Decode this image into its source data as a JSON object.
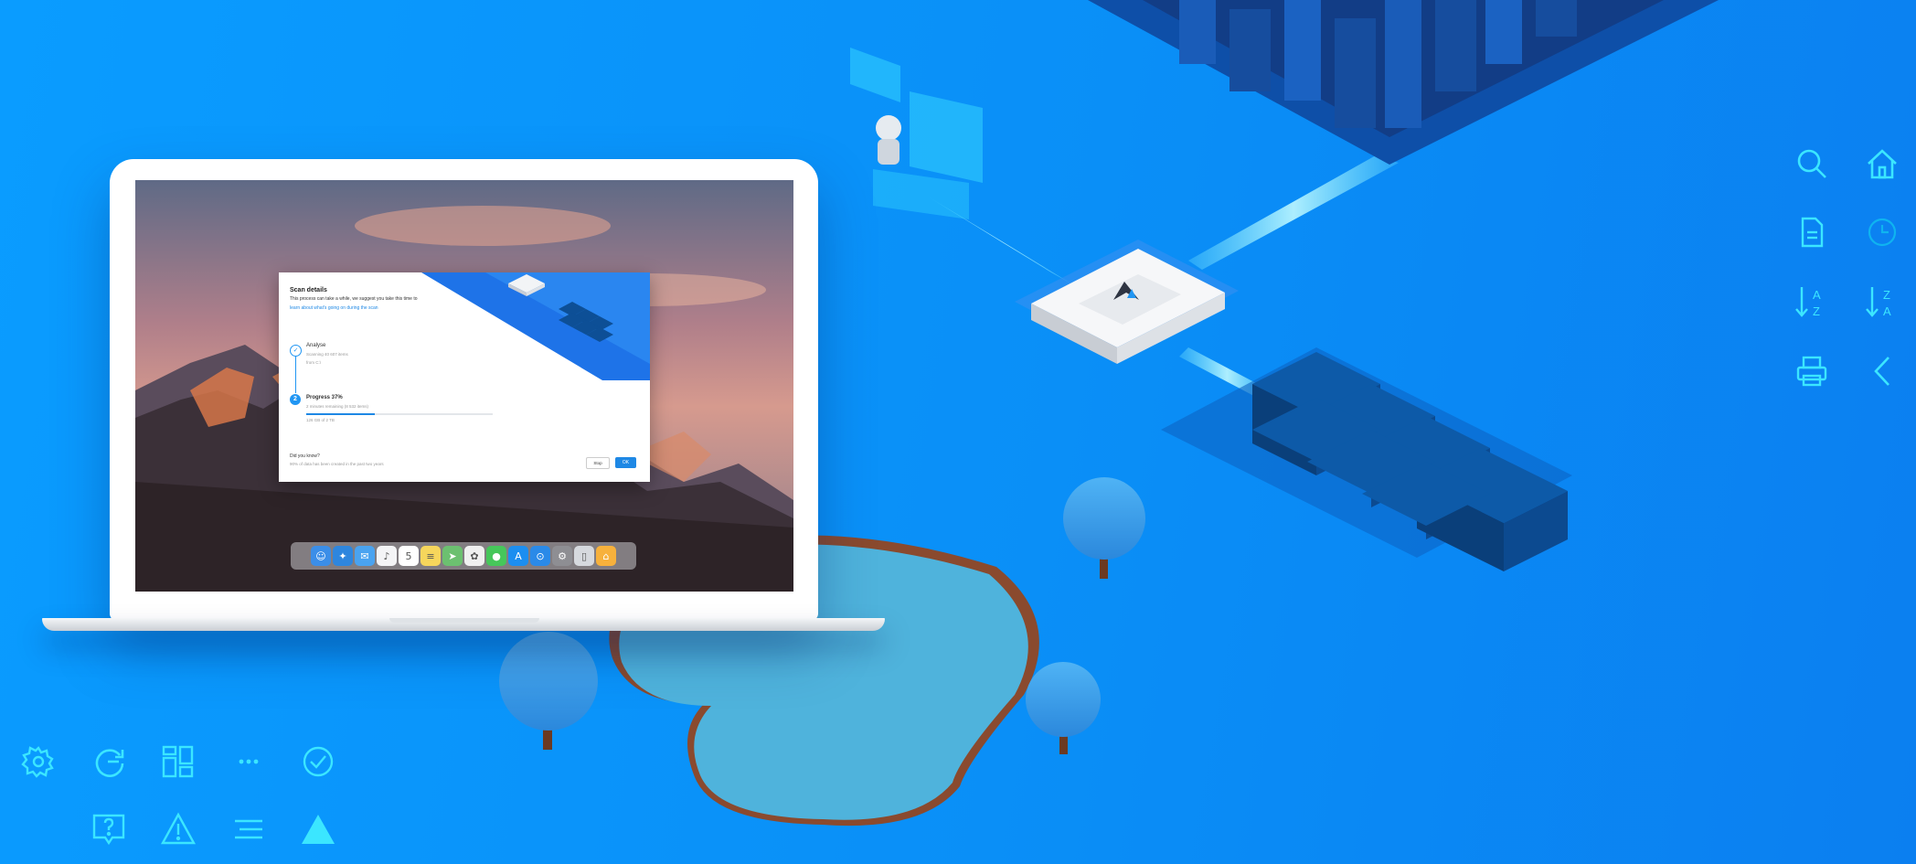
{
  "dialog": {
    "title": "Scan details",
    "description": "This process can take a while, we suggest you take this time to",
    "link": "learn about what's going on during the scan",
    "steps": [
      {
        "icon": "check-icon",
        "title": "Analyse",
        "line1": "Scanning 40 607 items",
        "line2": "from C:\\"
      },
      {
        "number": "2",
        "title": "Progress 37%",
        "line1": "2 minutes remaining (8 532 items)",
        "line2": "126 GB of 2 TB",
        "progress": 0.37
      }
    ],
    "did_you_know": "Did you know?",
    "fact": "90% of data has been created in the past two years",
    "stop_label": "Stop",
    "ok_label": "OK"
  },
  "dock": [
    {
      "name": "finder-icon",
      "glyph": "☺",
      "color": "#3b8ee8"
    },
    {
      "name": "safari-icon",
      "glyph": "✦",
      "color": "#2e86de"
    },
    {
      "name": "mail-icon",
      "glyph": "✉",
      "color": "#4aa3f0"
    },
    {
      "name": "music-icon",
      "glyph": "♪",
      "color": "#f4f4f6"
    },
    {
      "name": "calendar-icon",
      "glyph": "5",
      "color": "#ffffff"
    },
    {
      "name": "notes-icon",
      "glyph": "≡",
      "color": "#f6d65c"
    },
    {
      "name": "maps-icon",
      "glyph": "➤",
      "color": "#6cc070"
    },
    {
      "name": "photos-icon",
      "glyph": "✿",
      "color": "#f0f0f0"
    },
    {
      "name": "messages-icon",
      "glyph": "●",
      "color": "#46c75a"
    },
    {
      "name": "appstore-icon",
      "glyph": "A",
      "color": "#1c8ef0"
    },
    {
      "name": "finder2-icon",
      "glyph": "⊙",
      "color": "#2a8ae8"
    },
    {
      "name": "settings-icon",
      "glyph": "⚙",
      "color": "#8e8e93"
    },
    {
      "name": "trash-icon",
      "glyph": "▯",
      "color": "#d6d9de"
    },
    {
      "name": "home-app-icon",
      "glyph": "⌂",
      "color": "#f7b13c"
    }
  ],
  "colors": {
    "background": "#0a8ff7",
    "accent": "#1e88e5",
    "icon_cyan": "#3be6ff"
  },
  "icons_right": [
    "search-icon",
    "home-icon",
    "document-icon",
    "clock-icon",
    "sort-a-z-icon",
    "sort-z-a-icon",
    "printer-icon",
    "chevron-left-icon"
  ],
  "icons_bottom": [
    "gear-icon",
    "refresh-icon",
    "dashboard-icon",
    "more-icon",
    "check-circle-icon",
    "help-chat-icon",
    "warning-icon",
    "menu-icon",
    "triangle-icon"
  ]
}
